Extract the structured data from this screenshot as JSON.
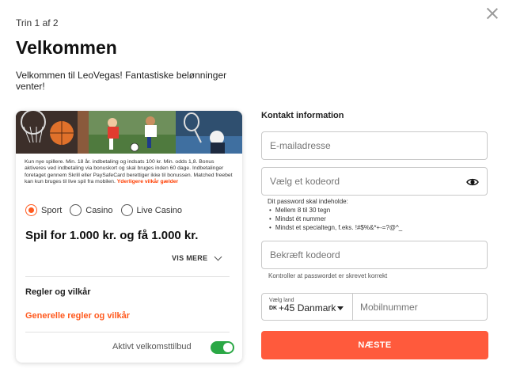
{
  "header": {
    "step": "Trin 1 af 2",
    "title": "Velkommen",
    "subtitle": "Velkommen til LeoVegas! Fantastiske belønninger venter!"
  },
  "promo": {
    "terms_text": "Kun nye spillere. Min. 18 år. indbetaling og indsats 100 kr. Min. odds 1,8. Bonus aktiveres ved indbetaling via bonuskort og skal bruges inden 60 dage. Indbetalinger foretaget gennem Skrill eller PaySafeCard berettiger ikke til bonussen. Matched freebet kan kun bruges til live spil fra mobilen.",
    "terms_link": "Yderligere vilkår gælder",
    "options": [
      "Sport",
      "Casino",
      "Live Casino"
    ],
    "selected_option": "Sport",
    "offer": "Spil for 1.000 kr. og få 1.000 kr.",
    "vis_mere": "VIS MERE",
    "rules_heading": "Regler og vilkår",
    "rules_link": "Generelle regler og vilkår",
    "toggle_label": "Aktivt velkomsttilbud",
    "toggle_on": true
  },
  "form": {
    "heading": "Kontakt information",
    "email_placeholder": "E-mailadresse",
    "password_placeholder": "Vælg et kodeord",
    "password_rules_title": "Dit password skal indeholde:",
    "password_rules": [
      "Mellem 8 til 30 tegn",
      "Mindst ét nummer",
      "Mindst et specialtegn, f.eks. !#$%&*+-=?@^_"
    ],
    "confirm_placeholder": "Bekræft kodeord",
    "confirm_hint": "Kontroller at passwordet er skrevet korrekt",
    "country_label": "Vælg land",
    "country_code": "DK",
    "country_value": "+45 Danmark",
    "mobile_placeholder": "Mobilnummer",
    "next_button": "NÆSTE"
  },
  "colors": {
    "accent": "#ff5a3c",
    "link": "#ff3d00",
    "toggle": "#2aa845"
  },
  "icons": {
    "close": "close-icon",
    "eye": "eye-icon",
    "chevron": "chevron-down-icon",
    "caret": "caret-down-icon"
  }
}
